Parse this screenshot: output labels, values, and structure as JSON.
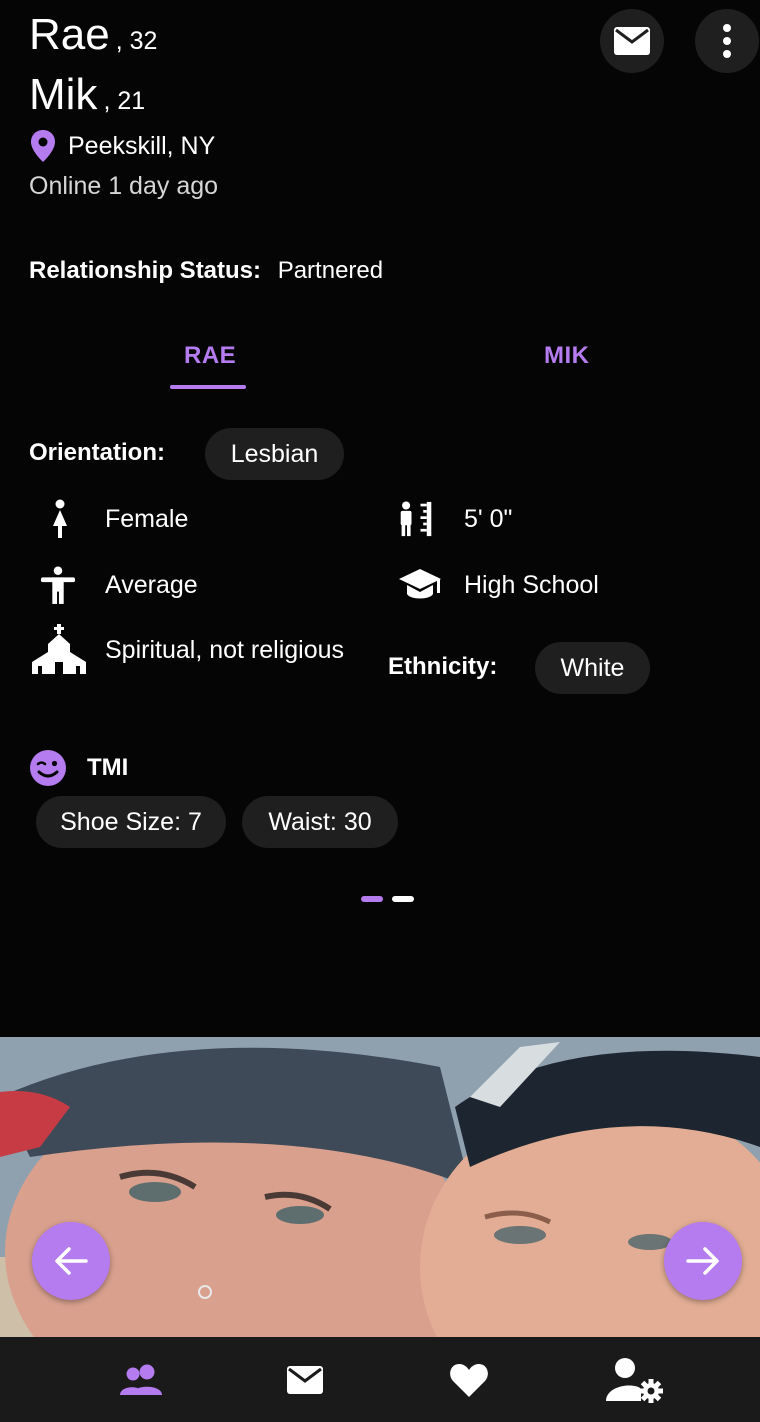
{
  "profile": {
    "person1": {
      "name": "Rae",
      "age": ", 32"
    },
    "person2": {
      "name": "Mik",
      "age": ", 21"
    },
    "location": "Peekskill, NY",
    "online": "Online 1 day ago",
    "relationship_label": "Relationship Status:",
    "relationship_value": "Partnered"
  },
  "tabs": [
    {
      "label": "RAE",
      "active": true
    },
    {
      "label": "MIK",
      "active": false
    }
  ],
  "details": {
    "orientation_label": "Orientation:",
    "orientation_value": "Lesbian",
    "gender": "Female",
    "height": "5' 0\"",
    "body_type": "Average",
    "education": "High School",
    "religion": "Spiritual, not religious",
    "ethnicity_label": "Ethnicity:",
    "ethnicity_value": "White"
  },
  "tmi": {
    "label": "TMI",
    "chips": [
      "Shoe Size: 7",
      "Waist: 30"
    ]
  },
  "pager": {
    "count": 2,
    "active_index": 0
  },
  "colors": {
    "accent": "#b57cf0",
    "background": "#050505",
    "chip": "#1f1f1f",
    "bottom_bar": "#1a1a1a"
  },
  "icons": {
    "header": [
      "mail-icon",
      "more-vert-icon"
    ],
    "bottom_nav": [
      "people-icon",
      "mail-icon",
      "heart-icon",
      "account-settings-icon"
    ]
  }
}
